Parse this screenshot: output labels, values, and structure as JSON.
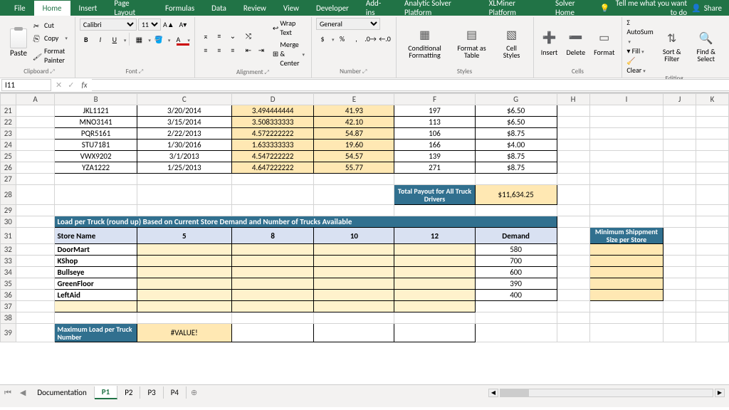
{
  "ribbon": {
    "tabs": [
      "File",
      "Home",
      "Insert",
      "Page Layout",
      "Formulas",
      "Data",
      "Review",
      "View",
      "Developer",
      "Add-ins",
      "Analytic Solver Platform",
      "XLMiner Platform",
      "Solver Home"
    ],
    "active_tab": "Home",
    "tell_me": "Tell me what you want to do",
    "share": "Share"
  },
  "clipboard": {
    "paste": "Paste",
    "cut": "Cut",
    "copy": "Copy",
    "format_painter": "Format Painter",
    "group": "Clipboard"
  },
  "font": {
    "name": "Calibri",
    "size": "11",
    "increase": "A▲",
    "decrease": "A▼",
    "group": "Font"
  },
  "alignment": {
    "wrap": "Wrap Text",
    "merge": "Merge & Center",
    "group": "Alignment"
  },
  "number": {
    "format": "General",
    "group": "Number"
  },
  "styles": {
    "conditional": "Conditional Formatting",
    "format_table": "Format as Table",
    "cell_styles": "Cell Styles",
    "group": "Styles"
  },
  "cells": {
    "insert": "Insert",
    "delete": "Delete",
    "format": "Format",
    "group": "Cells"
  },
  "editing": {
    "autosum": "AutoSum",
    "fill": "Fill",
    "clear": "Clear",
    "sort": "Sort & Filter",
    "find": "Find & Select",
    "group": "Editing"
  },
  "namebox": "I11",
  "columns": [
    "A",
    "B",
    "C",
    "D",
    "E",
    "F",
    "G",
    "H",
    "I",
    "J",
    "K"
  ],
  "rows_top": [
    {
      "r": 21,
      "B": "JKL1121",
      "C": "3/20/2014",
      "D": "3.494444444",
      "E": "41.93",
      "F": "197",
      "G": "$6.50"
    },
    {
      "r": 22,
      "B": "MNO3141",
      "C": "3/15/2014",
      "D": "3.508333333",
      "E": "42.10",
      "F": "113",
      "G": "$6.50"
    },
    {
      "r": 23,
      "B": "PQR5161",
      "C": "2/22/2013",
      "D": "4.572222222",
      "E": "54.87",
      "F": "106",
      "G": "$8.75"
    },
    {
      "r": 24,
      "B": "STU7181",
      "C": "1/30/2016",
      "D": "1.633333333",
      "E": "19.60",
      "F": "166",
      "G": "$4.00"
    },
    {
      "r": 25,
      "B": "VWX9202",
      "C": "3/1/2013",
      "D": "4.547222222",
      "E": "54.57",
      "F": "139",
      "G": "$8.75"
    },
    {
      "r": 26,
      "B": "YZA1222",
      "C": "1/25/2013",
      "D": "4.647222222",
      "E": "55.77",
      "F": "271",
      "G": "$8.75"
    }
  ],
  "payout": {
    "label": "Total Payout for All Truck Drivers",
    "value": "$11,634.25"
  },
  "section2": {
    "title": "Load per Truck (round up) Based on Current Store Demand and Number of Trucks Available",
    "store_header": "Store Name",
    "truck_cols": [
      "5",
      "8",
      "10",
      "12"
    ],
    "demand_header": "Demand",
    "min_ship": "Minimum Shippment Size per Store",
    "stores": [
      {
        "name": "DoorMart",
        "demand": "580"
      },
      {
        "name": "KShop",
        "demand": "700"
      },
      {
        "name": "Bullseye",
        "demand": "600"
      },
      {
        "name": "GreenFloor",
        "demand": "390"
      },
      {
        "name": "LeftAid",
        "demand": "400"
      }
    ]
  },
  "section3": {
    "label": "Maximum Load per Truck Number",
    "value": "#VALUE!"
  },
  "sheets": {
    "tabs": [
      "Documentation",
      "P1",
      "P2",
      "P3",
      "P4"
    ],
    "active": "P1"
  }
}
